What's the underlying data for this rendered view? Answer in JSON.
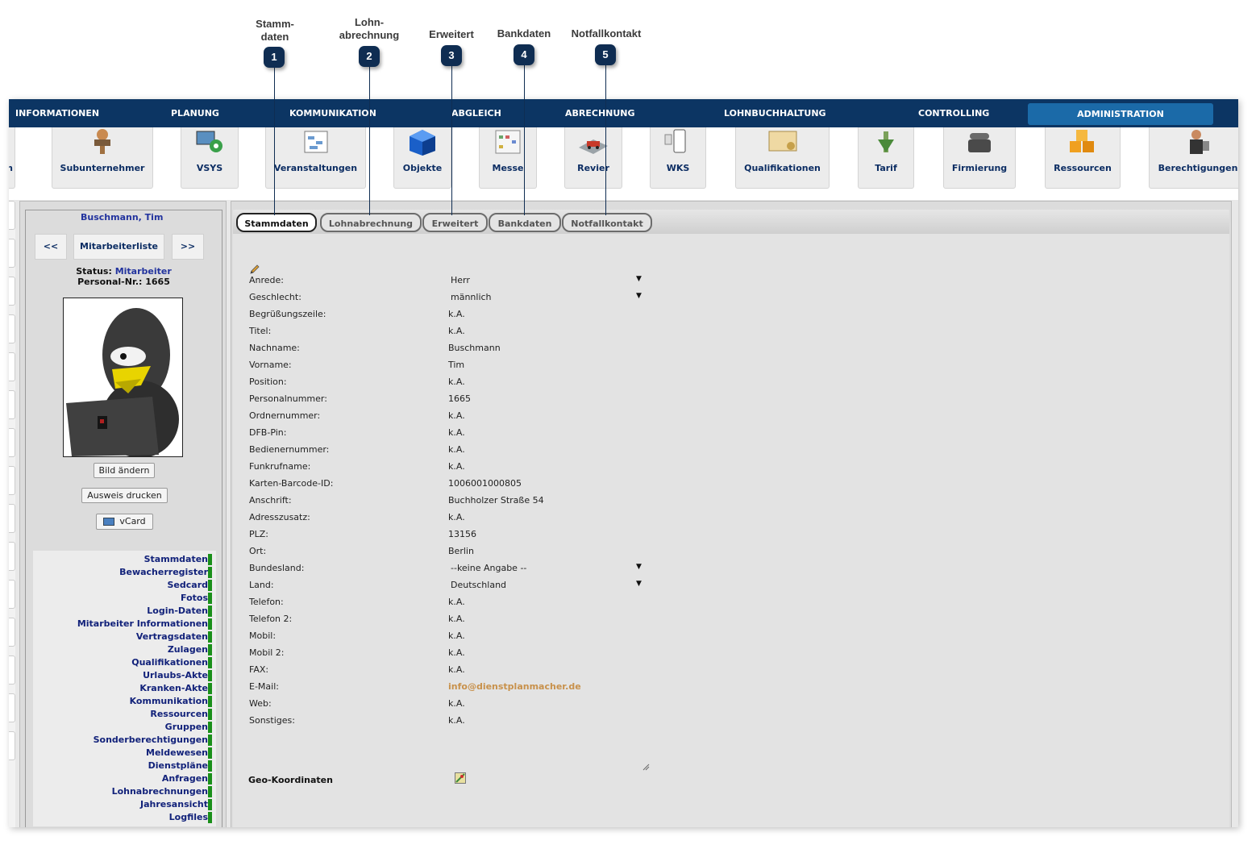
{
  "callouts": [
    {
      "number": "1",
      "label_line1": "Stamm-",
      "label_line2": "daten"
    },
    {
      "number": "2",
      "label_line1": "Lohn-",
      "label_line2": "abrechnung"
    },
    {
      "number": "3",
      "label_line1": "Erweitert",
      "label_line2": ""
    },
    {
      "number": "4",
      "label_line1": "Bankdaten",
      "label_line2": ""
    },
    {
      "number": "5",
      "label_line1": "Notfallkontakt",
      "label_line2": ""
    }
  ],
  "topnav": {
    "items": [
      "INFORMATIONEN",
      "PLANUNG",
      "KOMMUNIKATION",
      "ABGLEICH",
      "ABRECHNUNG",
      "LOHNBUCHHALTUNG",
      "CONTROLLING",
      "ADMINISTRATION"
    ],
    "active": "ADMINISTRATION"
  },
  "iconbar": {
    "items": [
      "n",
      "Subunternehmer",
      "VSYS",
      "Veranstaltungen",
      "Objekte",
      "Messe",
      "Revier",
      "WKS",
      "Qualifikationen",
      "Tarif",
      "Firmierung",
      "Ressourcen",
      "Berechtigungen"
    ]
  },
  "person": {
    "name": "Buschmann, Tim",
    "prev_label": "<<",
    "list_label": "Mitarbeiterliste",
    "next_label": ">>",
    "status_label": "Status:",
    "status_value": "Mitarbeiter",
    "personal_nr_label": "Personal-Nr.:",
    "personal_nr_value": "1665",
    "change_picture_label": "Bild ändern",
    "print_id_label": "Ausweis drucken",
    "vcard_label": "vCard"
  },
  "sidebar_menu": [
    "Stammdaten",
    "Bewacherregister",
    "Sedcard",
    "Fotos",
    "Login-Daten",
    "Mitarbeiter Informationen",
    "Vertragsdaten",
    "Zulagen",
    "Qualifikationen",
    "Urlaubs-Akte",
    "Kranken-Akte",
    "Kommunikation",
    "Ressourcen",
    "Gruppen",
    "Sonderberechtigungen",
    "Meldewesen",
    "Dienstpläne",
    "Anfragen",
    "Lohnabrechnungen",
    "Jahresansicht",
    "Logfiles"
  ],
  "tabs": [
    "Stammdaten",
    "Lohnabrechnung",
    "Erweitert",
    "Bankdaten",
    "Notfallkontakt"
  ],
  "active_tab": "Stammdaten",
  "fields": [
    {
      "label": "Anrede:",
      "value": "Herr",
      "dropdown": true
    },
    {
      "label": "Geschlecht:",
      "value": "männlich",
      "dropdown": true
    },
    {
      "label": "Begrüßungszeile:",
      "value": "k.A."
    },
    {
      "label": "Titel:",
      "value": "k.A."
    },
    {
      "label": "Nachname:",
      "value": "Buschmann"
    },
    {
      "label": "Vorname:",
      "value": "Tim"
    },
    {
      "label": "Position:",
      "value": "k.A."
    },
    {
      "label": "Personalnummer:",
      "value": "1665"
    },
    {
      "label": "Ordnernummer:",
      "value": "k.A."
    },
    {
      "label": "DFB-Pin:",
      "value": "k.A."
    },
    {
      "label": "Bedienernummer:",
      "value": "k.A."
    },
    {
      "label": "Funkrufname:",
      "value": "k.A."
    },
    {
      "label": "Karten-Barcode-ID:",
      "value": "1006001000805"
    },
    {
      "label": "Anschrift:",
      "value": "Buchholzer Straße 54"
    },
    {
      "label": "Adresszusatz:",
      "value": "k.A."
    },
    {
      "label": "PLZ:",
      "value": "13156"
    },
    {
      "label": "Ort:",
      "value": "Berlin"
    },
    {
      "label": "Bundesland:",
      "value": "--keine Angabe --",
      "dropdown": true
    },
    {
      "label": "Land:",
      "value": "Deutschland",
      "dropdown": true
    },
    {
      "label": "Telefon:",
      "value": "k.A."
    },
    {
      "label": "Telefon 2:",
      "value": "k.A."
    },
    {
      "label": "Mobil:",
      "value": "k.A."
    },
    {
      "label": "Mobil 2:",
      "value": "k.A."
    },
    {
      "label": "FAX:",
      "value": "k.A."
    },
    {
      "label": "E-Mail:",
      "value": "info@dienstplanmacher.de",
      "link": true
    },
    {
      "label": "Web:",
      "value": "k.A."
    },
    {
      "label": "Sonstiges:",
      "value": "k.A."
    }
  ],
  "geo_label": "Geo-Koordinaten",
  "colors": {
    "nav_bg": "#0c3563",
    "nav_active": "#1b6aa8",
    "callout": "#0f2d52",
    "link": "#c8914b",
    "menu_text": "#12227a",
    "menu_bar": "#1a8f1a"
  }
}
